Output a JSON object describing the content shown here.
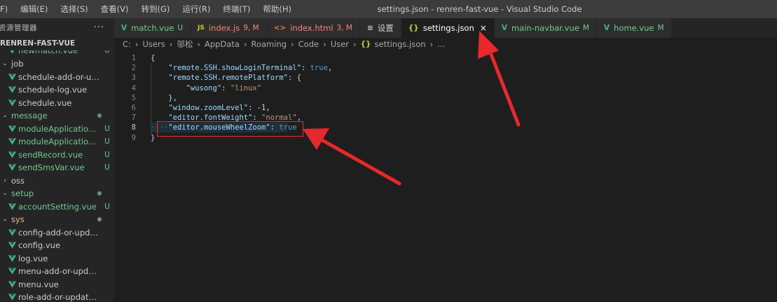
{
  "menu": {
    "items": [
      "F)",
      "编辑(E)",
      "选择(S)",
      "查看(V)",
      "转到(G)",
      "运行(R)",
      "终端(T)",
      "帮助(H)"
    ]
  },
  "window_title": "settings.json - renren-fast-vue - Visual Studio Code",
  "sidebar": {
    "title": "资源管理器",
    "more": "···",
    "section": "RENREN-FAST-VUE",
    "partial_item": {
      "label": "newmatch.vue",
      "badge": "U"
    },
    "items": [
      {
        "type": "folder",
        "label": "job",
        "badge": ""
      },
      {
        "type": "file",
        "label": "schedule-add-or-update....",
        "badge": ""
      },
      {
        "type": "file",
        "label": "schedule-log.vue",
        "badge": ""
      },
      {
        "type": "file",
        "label": "schedule.vue",
        "badge": ""
      },
      {
        "type": "folder",
        "label": "message",
        "badge": "dot"
      },
      {
        "type": "file",
        "label": "moduleApplication....",
        "badge": "U"
      },
      {
        "type": "file",
        "label": "moduleApplication....",
        "badge": "U"
      },
      {
        "type": "file",
        "label": "sendRecord.vue",
        "badge": "U"
      },
      {
        "type": "file",
        "label": "sendSmsVar.vue",
        "badge": "U"
      },
      {
        "type": "folder-collapsed",
        "label": "oss",
        "badge": ""
      },
      {
        "type": "folder",
        "label": "setup",
        "badge": "dot"
      },
      {
        "type": "file",
        "label": "accountSetting.vue",
        "badge": "U"
      },
      {
        "type": "folder",
        "label": "sys",
        "badge": "dot"
      },
      {
        "type": "file",
        "label": "config-add-or-update.vue",
        "badge": ""
      },
      {
        "type": "file",
        "label": "config.vue",
        "badge": ""
      },
      {
        "type": "file",
        "label": "log.vue",
        "badge": ""
      },
      {
        "type": "file",
        "label": "menu-add-or-update.vue",
        "badge": ""
      },
      {
        "type": "file",
        "label": "menu.vue",
        "badge": ""
      },
      {
        "type": "file",
        "label": "role-add-or-update.vue",
        "badge": ""
      }
    ]
  },
  "tabs": [
    {
      "icon": "V",
      "label": "match.vue",
      "mark": "U",
      "kind": "vue"
    },
    {
      "icon": "JS",
      "label": "index.js",
      "mark": "9, M",
      "kind": "js"
    },
    {
      "icon": "<>",
      "label": "index.html",
      "mark": "3, M",
      "kind": "html"
    },
    {
      "icon": "≡",
      "label": "设置",
      "mark": "",
      "kind": "settings"
    },
    {
      "icon": "{}",
      "label": "settings.json",
      "mark": "",
      "kind": "json",
      "active": true,
      "close": "×"
    },
    {
      "icon": "V",
      "label": "main-navbar.vue",
      "mark": "M",
      "kind": "vue"
    },
    {
      "icon": "V",
      "label": "home.vue",
      "mark": "M",
      "kind": "vue"
    }
  ],
  "breadcrumb": {
    "parts": [
      "C:",
      "Users",
      "邬松",
      "AppData",
      "Roaming",
      "Code",
      "User"
    ],
    "file_icon": "{}",
    "file": "settings.json",
    "tail": "..."
  },
  "editor": {
    "lines": [
      {
        "n": "1",
        "tokens": [
          [
            "p",
            "{"
          ]
        ]
      },
      {
        "n": "2",
        "tokens": [
          [
            "p",
            "    "
          ],
          [
            "k",
            "\"remote.SSH.showLoginTerminal\""
          ],
          [
            "p",
            ": "
          ],
          [
            "b",
            "true"
          ],
          [
            "p",
            ","
          ]
        ]
      },
      {
        "n": "3",
        "tokens": [
          [
            "p",
            "    "
          ],
          [
            "k",
            "\"remote.SSH.remotePlatform\""
          ],
          [
            "p",
            ": {"
          ]
        ]
      },
      {
        "n": "4",
        "tokens": [
          [
            "p",
            "        "
          ],
          [
            "k",
            "\"wusong\""
          ],
          [
            "p",
            ": "
          ],
          [
            "s",
            "\"linux\""
          ]
        ]
      },
      {
        "n": "5",
        "tokens": [
          [
            "p",
            "    },"
          ]
        ]
      },
      {
        "n": "6",
        "tokens": [
          [
            "p",
            "    "
          ],
          [
            "k",
            "\"window.zoomLevel\""
          ],
          [
            "p",
            ": -1,"
          ]
        ]
      },
      {
        "n": "7",
        "tokens": [
          [
            "p",
            "    "
          ],
          [
            "k",
            "\"editor.fontWeight\""
          ],
          [
            "p",
            ": "
          ],
          [
            "s",
            "\"normal\""
          ],
          [
            "p",
            ","
          ]
        ]
      },
      {
        "n": "8",
        "tokens": [
          [
            "w",
            "····"
          ],
          [
            "k",
            "\"editor.mouseWheelZoom\""
          ],
          [
            "p",
            ": "
          ],
          [
            "b",
            "true"
          ]
        ],
        "current": true
      },
      {
        "n": "9",
        "tokens": [
          [
            "p",
            "}"
          ]
        ]
      }
    ]
  },
  "colors": {
    "accent_red": "#e0322c",
    "vue_green": "#41b883",
    "git_untracked": "#73c991",
    "git_modified_red": "#f48771"
  }
}
